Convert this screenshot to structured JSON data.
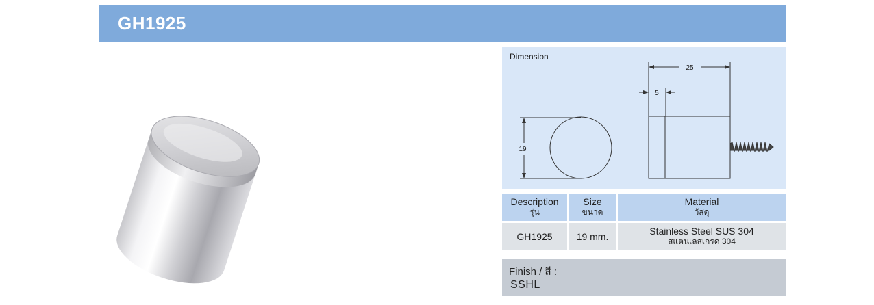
{
  "product": {
    "code": "GH1925"
  },
  "dimension": {
    "label": "Dimension",
    "total_length": "25",
    "cap_length": "5",
    "diameter": "19"
  },
  "spec_table": {
    "headers": [
      {
        "en": "Description",
        "th": "รุ่น"
      },
      {
        "en": "Size",
        "th": "ขนาด"
      },
      {
        "en": "Material",
        "th": "วัสดุ"
      }
    ],
    "row": {
      "description": "GH1925",
      "size": "19 mm.",
      "material_en": "Stainless Steel SUS 304",
      "material_th": "สแตนเลสเกรด 304"
    }
  },
  "finish": {
    "label": "Finish / สี :",
    "value": "SSHL"
  },
  "colors": {
    "title_bar": "#7faadb",
    "dimension_bg": "#d9e7f8",
    "header_bg": "#bcd3ef",
    "cell_bg": "#dfe3e7",
    "finish_bg": "#c5cbd3"
  }
}
